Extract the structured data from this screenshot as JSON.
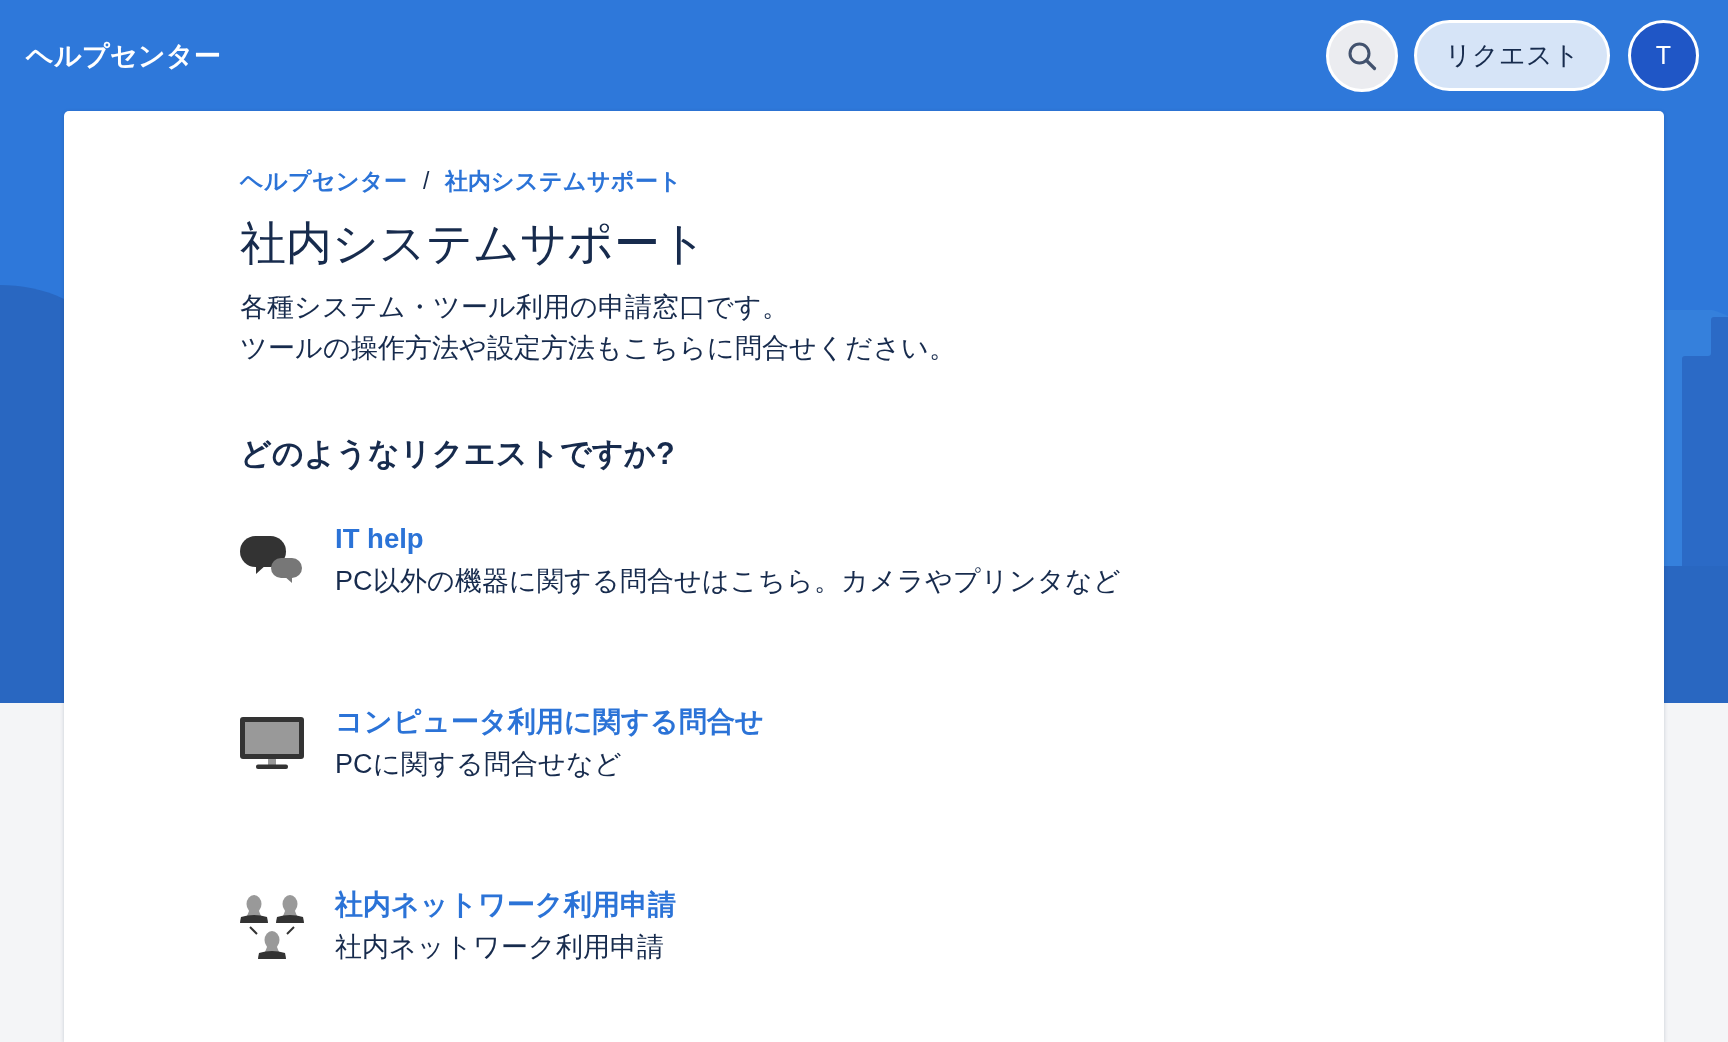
{
  "header": {
    "title": "ヘルプセンター",
    "request_button": "リクエスト",
    "avatar_initial": "T"
  },
  "breadcrumb": {
    "items": [
      "ヘルプセンター",
      "社内システムサポート"
    ],
    "separator": "/"
  },
  "portal": {
    "title": "社内システムサポート",
    "description": [
      "各種システム・ツール利用の申請窓口です。",
      "ツールの操作方法や設定方法もこちらに問合せください。"
    ]
  },
  "request_types": {
    "heading": "どのようなリクエストですか?",
    "items": [
      {
        "kind": "chat",
        "title": "IT help",
        "description": "PC以外の機器に関する問合せはこちら。カメラやプリンタなど"
      },
      {
        "kind": "computer",
        "title": "コンピュータ利用に関する問合せ",
        "description": "PCに関する問合せなど"
      },
      {
        "kind": "people",
        "title": "社内ネットワーク利用申請",
        "description": "社内ネットワーク利用申請"
      }
    ]
  }
}
